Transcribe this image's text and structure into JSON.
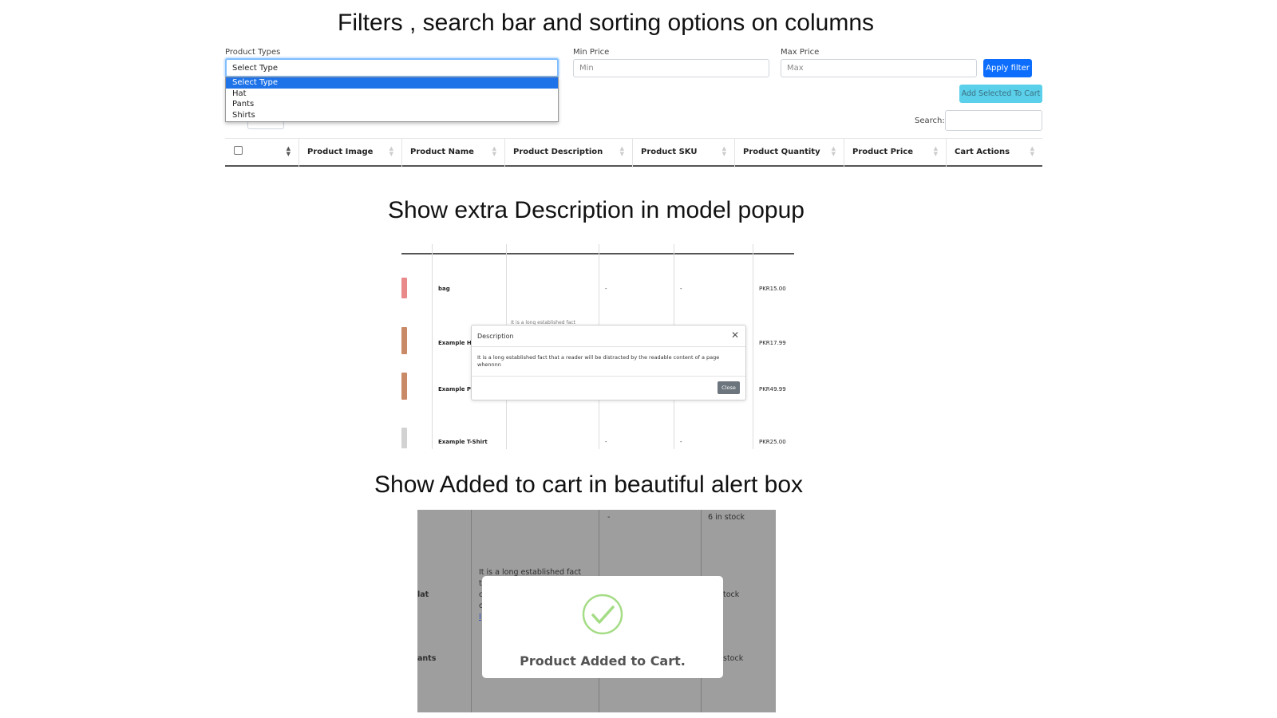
{
  "headings": {
    "filters": "Filters , search bar and sorting options on columns",
    "description": "Show extra Description in model popup",
    "alert": "Show Added to cart in beautiful alert box"
  },
  "filters": {
    "product_types_label": "Product Types",
    "select_value": "Select Type",
    "options": [
      "Select Type",
      "Hat",
      "Pants",
      "Shirts"
    ],
    "min_price_label": "Min Price",
    "min_placeholder": "Min",
    "max_price_label": "Max Price",
    "max_placeholder": "Max",
    "apply_label": "Apply filter",
    "add_selected_label": "Add Selected To Cart",
    "search_label": "Search:"
  },
  "table": {
    "columns": [
      "Product Image",
      "Product Name",
      "Product Description",
      "Product SKU",
      "Product Quantity",
      "Product Price",
      "Cart Actions"
    ]
  },
  "modal_section": {
    "rows": [
      {
        "name": "bag",
        "sku": "-",
        "qty": "-",
        "price": "PKR15.00",
        "thumb_color": "#e88a8a"
      },
      {
        "name": "Example Ha",
        "price": "PKR17.99",
        "thumb_color": "#c98b67"
      },
      {
        "name": "Example Pa",
        "price": "PKR49.99",
        "thumb_color": "#c98b67"
      },
      {
        "name": "Example T-Shirt",
        "sku": "-",
        "qty": "-",
        "price": "PKR25.00",
        "thumb_color": "#d2d2d2"
      }
    ],
    "partial_text": "It is a long established fact",
    "modal": {
      "title": "Description",
      "close_icon": "close-icon",
      "body": "It is a long established fact that a reader will be distracted by the readable content of a page whennnn",
      "close_label": "Close"
    }
  },
  "alert_section": {
    "dash": "-",
    "stock_top": "6 in stock",
    "description_fragment": "It is a long established fact",
    "letter_t": "t",
    "letter_c1": "c",
    "letter_c2": "c",
    "link_fragment": "I",
    "row_hat": "lat",
    "row_pants": "ants",
    "stock_hat": "tock",
    "stock_pants": "stock",
    "alert_icon": "success-check-icon",
    "alert_message": "Product Added to Cart.",
    "success_color": "#a5dc86"
  }
}
